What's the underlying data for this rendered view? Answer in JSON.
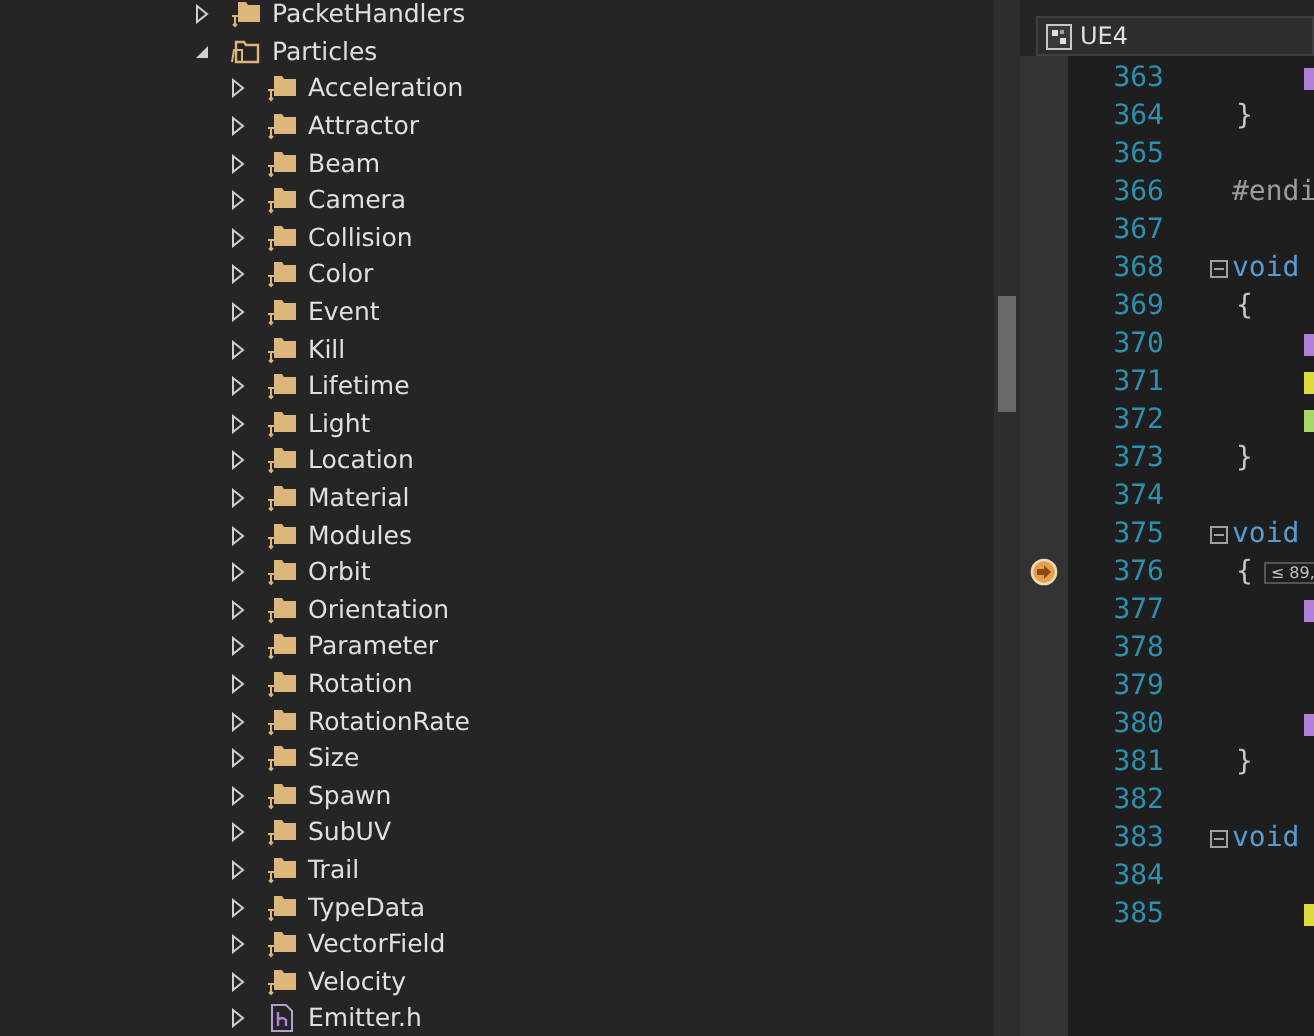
{
  "tree": [
    {
      "label": "PacketHandlers",
      "kind": "filter",
      "expanded": false
    },
    {
      "label": "Particles",
      "kind": "filter",
      "expanded": true,
      "children": [
        {
          "label": "Acceleration",
          "kind": "filter",
          "expanded": false
        },
        {
          "label": "Attractor",
          "kind": "filter",
          "expanded": false
        },
        {
          "label": "Beam",
          "kind": "filter",
          "expanded": false
        },
        {
          "label": "Camera",
          "kind": "filter",
          "expanded": false
        },
        {
          "label": "Collision",
          "kind": "filter",
          "expanded": false
        },
        {
          "label": "Color",
          "kind": "filter",
          "expanded": false
        },
        {
          "label": "Event",
          "kind": "filter",
          "expanded": false
        },
        {
          "label": "Kill",
          "kind": "filter",
          "expanded": false
        },
        {
          "label": "Lifetime",
          "kind": "filter",
          "expanded": false
        },
        {
          "label": "Light",
          "kind": "filter",
          "expanded": false
        },
        {
          "label": "Location",
          "kind": "filter",
          "expanded": false
        },
        {
          "label": "Material",
          "kind": "filter",
          "expanded": false
        },
        {
          "label": "Modules",
          "kind": "filter",
          "expanded": false
        },
        {
          "label": "Orbit",
          "kind": "filter",
          "expanded": false
        },
        {
          "label": "Orientation",
          "kind": "filter",
          "expanded": false
        },
        {
          "label": "Parameter",
          "kind": "filter",
          "expanded": false
        },
        {
          "label": "Rotation",
          "kind": "filter",
          "expanded": false
        },
        {
          "label": "RotationRate",
          "kind": "filter",
          "expanded": false
        },
        {
          "label": "Size",
          "kind": "filter",
          "expanded": false
        },
        {
          "label": "Spawn",
          "kind": "filter",
          "expanded": false
        },
        {
          "label": "SubUV",
          "kind": "filter",
          "expanded": false
        },
        {
          "label": "Trail",
          "kind": "filter",
          "expanded": false
        },
        {
          "label": "TypeData",
          "kind": "filter",
          "expanded": false
        },
        {
          "label": "VectorField",
          "kind": "filter",
          "expanded": false
        },
        {
          "label": "Velocity",
          "kind": "filter",
          "expanded": false
        },
        {
          "label": "Emitter.h",
          "kind": "header",
          "expanded": false
        }
      ]
    }
  ],
  "editor": {
    "project": "UE4",
    "lines": [
      {
        "number": "363",
        "fold": false,
        "breakpoint": false,
        "color": "#b180d7"
      },
      {
        "number": "364",
        "code": "}",
        "kind": "brace",
        "fold": false,
        "breakpoint": false
      },
      {
        "number": "365",
        "fold": false,
        "breakpoint": false
      },
      {
        "number": "366",
        "code": "#endi",
        "kind": "preprocessor",
        "fold": false,
        "breakpoint": false
      },
      {
        "number": "367",
        "fold": false,
        "breakpoint": false
      },
      {
        "number": "368",
        "code": "void",
        "kind": "keyword",
        "fold": true,
        "breakpoint": false
      },
      {
        "number": "369",
        "code": "{",
        "kind": "brace",
        "fold": false,
        "breakpoint": false
      },
      {
        "number": "370",
        "fold": false,
        "breakpoint": false,
        "color": "#b180d7"
      },
      {
        "number": "371",
        "fold": false,
        "breakpoint": false,
        "color": "#dcdc3c"
      },
      {
        "number": "372",
        "fold": false,
        "breakpoint": false,
        "color": "#a6d96a"
      },
      {
        "number": "373",
        "code": "}",
        "kind": "brace",
        "fold": false,
        "breakpoint": false
      },
      {
        "number": "374",
        "fold": false,
        "breakpoint": false
      },
      {
        "number": "375",
        "code": "void",
        "kind": "keyword",
        "fold": true,
        "breakpoint": false
      },
      {
        "number": "376",
        "code": "{",
        "kind": "brace",
        "hint": "≤ 89,",
        "fold": false,
        "breakpoint": true
      },
      {
        "number": "377",
        "fold": false,
        "breakpoint": false,
        "color": "#b180d7"
      },
      {
        "number": "378",
        "fold": false,
        "breakpoint": false
      },
      {
        "number": "379",
        "fold": false,
        "breakpoint": false
      },
      {
        "number": "380",
        "fold": false,
        "breakpoint": false,
        "color": "#b180d7"
      },
      {
        "number": "381",
        "code": "}",
        "kind": "brace",
        "fold": false,
        "breakpoint": false
      },
      {
        "number": "382",
        "fold": false,
        "breakpoint": false
      },
      {
        "number": "383",
        "code": "void",
        "kind": "keyword",
        "fold": true,
        "breakpoint": false
      },
      {
        "number": "384",
        "fold": false,
        "breakpoint": false
      },
      {
        "number": "385",
        "fold": false,
        "breakpoint": false,
        "color": "#dcdc3c"
      }
    ]
  }
}
